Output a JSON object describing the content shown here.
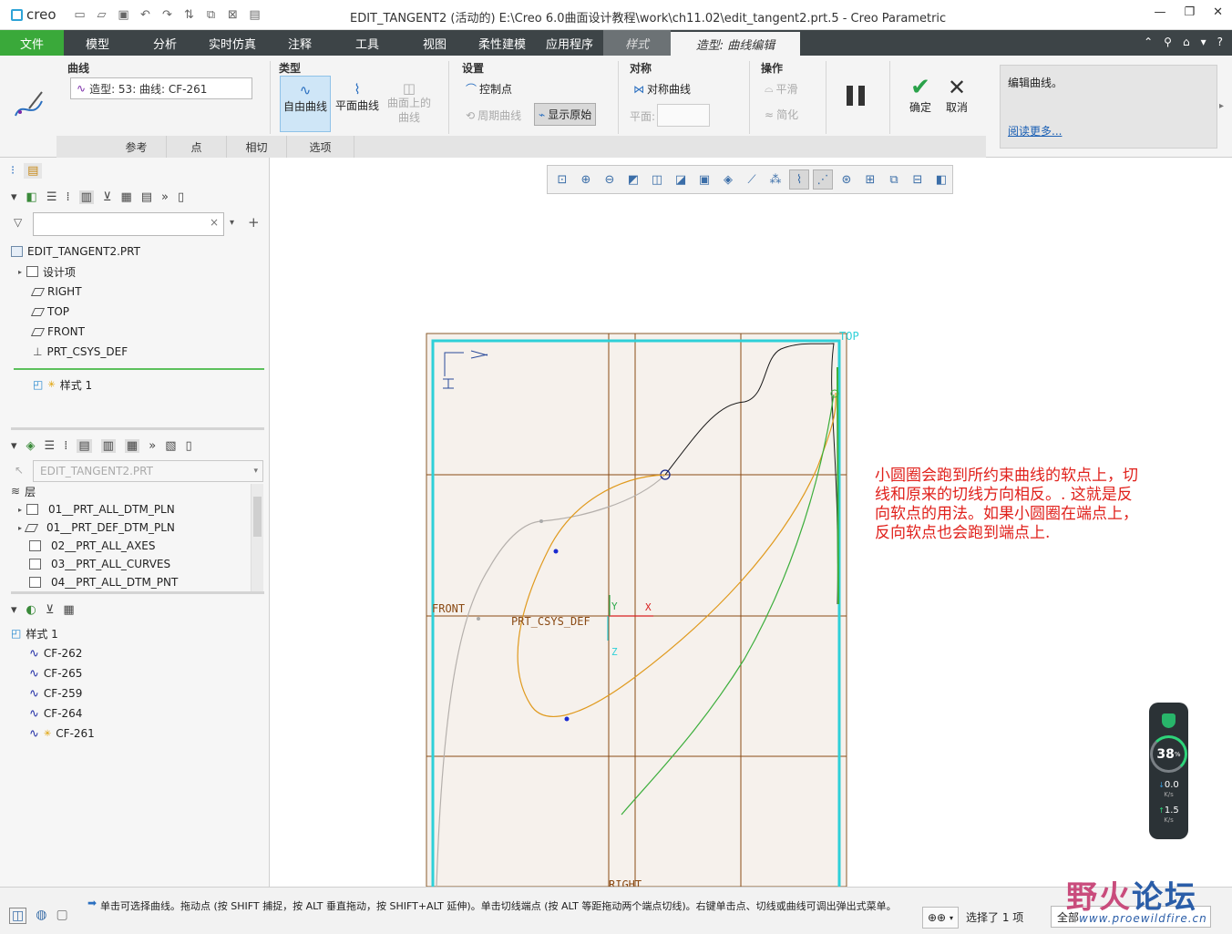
{
  "titlebar": {
    "app_name": "creo",
    "title": "EDIT_TANGENT2 (活动的) E:\\Creo 6.0曲面设计教程\\work\\ch11.02\\edit_tangent2.prt.5 - Creo Parametric"
  },
  "menu": {
    "file": "文件",
    "tabs": [
      "模型",
      "分析",
      "实时仿真",
      "注释",
      "工具",
      "视图",
      "柔性建模",
      "应用程序"
    ],
    "style": "样式",
    "active": "造型: 曲线编辑"
  },
  "ribbon": {
    "curve_group": {
      "title": "曲线",
      "field_value": "造型: 53: 曲线: CF-261"
    },
    "type_group": {
      "title": "类型",
      "free": "自由曲线",
      "planar": "平面曲线",
      "on_surface": "曲面上的曲线"
    },
    "settings_group": {
      "title": "设置",
      "control_points": "控制点",
      "periodic": "周期曲线",
      "show_original": "显示原始"
    },
    "symmetry_group": {
      "title": "对称",
      "symmetric_curve": "对称曲线",
      "plane_label": "平面:"
    },
    "operations_group": {
      "title": "操作",
      "smooth": "平滑",
      "simplify": "简化"
    },
    "ok": "确定",
    "cancel": "取消",
    "subtabs": [
      "参考",
      "点",
      "相切",
      "选项"
    ],
    "help": {
      "text": "编辑曲线。",
      "link": "阅读更多..."
    }
  },
  "model_tree": {
    "root": "EDIT_TANGENT2.PRT",
    "items": [
      "设计项",
      "RIGHT",
      "TOP",
      "FRONT",
      "PRT_CSYS_DEF"
    ],
    "style_item": "样式 1"
  },
  "layers": {
    "combo": "EDIT_TANGENT2.PRT",
    "header": "层",
    "items": [
      "01__PRT_ALL_DTM_PLN",
      "01__PRT_DEF_DTM_PLN",
      "02__PRT_ALL_AXES",
      "03__PRT_ALL_CURVES",
      "04__PRT_ALL_DTM_PNT"
    ]
  },
  "style_tree": {
    "root": "样式 1",
    "curves": [
      "CF-262",
      "CF-265",
      "CF-259",
      "CF-264",
      "CF-261"
    ]
  },
  "canvas": {
    "labels": {
      "top": "TOP",
      "front": "FRONT",
      "right": "RIGHT",
      "csys": "PRT_CSYS_DEF",
      "axis_x": "X",
      "axis_y": "Y",
      "axis_z": "Z"
    },
    "annotation": "小圆圈会跑到所约束曲线的软点上，切线和原来的切线方向相反。. 这就是反向软点的用法。如果小圆圈在端点上，反向软点也会跑到端点上."
  },
  "net_widget": {
    "percent": "38",
    "percent_unit": "%",
    "down": "0.0",
    "up": "1.5",
    "unit": "K/s"
  },
  "statusbar": {
    "message": "单击可选择曲线。拖动点 (按 SHIFT 捕捉，按 ALT 垂直拖动，按 SHIFT+ALT 延伸)。单击切线端点 (按 ALT 等距拖动两个端点切线)。右键单击点、切线或曲线可调出弹出式菜单。",
    "selected": "选择了 1 项",
    "filter": "全部"
  },
  "watermark": {
    "cn_a": "野火",
    "cn_b": "论坛",
    "url": "www.proewildfire.cn"
  },
  "colors": {
    "menu_bg": "#3d4447",
    "file_green": "#3aa93a",
    "orange_curve": "#e09a1e",
    "green_curve": "#3cae3c",
    "annotation_red": "#e0201b"
  }
}
